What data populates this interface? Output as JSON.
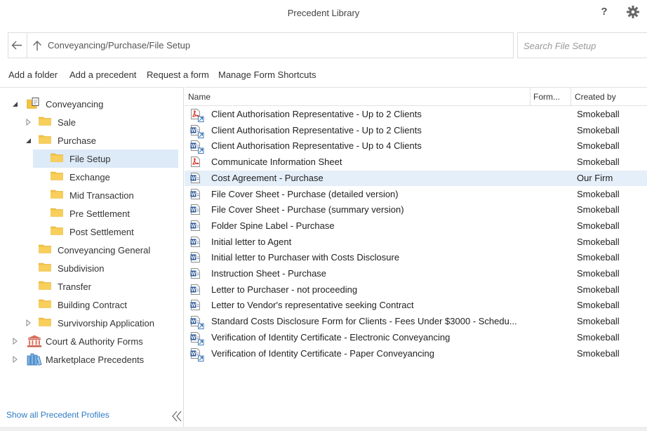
{
  "window": {
    "title": "Precedent Library",
    "help_label": "?"
  },
  "path": {
    "value": "Conveyancing/Purchase/File Setup"
  },
  "search": {
    "placeholder": "Search File Setup"
  },
  "toolbar": {
    "add_folder": "Add a folder",
    "add_precedent": "Add a precedent",
    "request_form": "Request a form",
    "manage_shortcuts": "Manage Form Shortcuts"
  },
  "tree": [
    {
      "label": "Conveyancing",
      "level": 0,
      "expanded": true,
      "icon": "conveyancing-icon"
    },
    {
      "label": "Sale",
      "level": 1,
      "expanded": false,
      "icon": "folder-icon"
    },
    {
      "label": "Purchase",
      "level": 1,
      "expanded": true,
      "icon": "folder-icon"
    },
    {
      "label": "File Setup",
      "level": 2,
      "selected": true,
      "icon": "folder-icon"
    },
    {
      "label": "Exchange",
      "level": 2,
      "icon": "folder-icon"
    },
    {
      "label": "Mid Transaction",
      "level": 2,
      "icon": "folder-icon"
    },
    {
      "label": "Pre Settlement",
      "level": 2,
      "icon": "folder-icon"
    },
    {
      "label": "Post Settlement",
      "level": 2,
      "icon": "folder-icon"
    },
    {
      "label": "Conveyancing General",
      "level": 1,
      "icon": "folder-icon"
    },
    {
      "label": "Subdivision",
      "level": 1,
      "icon": "folder-icon"
    },
    {
      "label": "Transfer",
      "level": 1,
      "icon": "folder-icon"
    },
    {
      "label": "Building Contract",
      "level": 1,
      "icon": "folder-icon"
    },
    {
      "label": "Survivorship Application",
      "level": 1,
      "expanded": false,
      "icon": "folder-icon"
    },
    {
      "label": "Court & Authority Forms",
      "level": 0,
      "expanded": false,
      "icon": "court-icon"
    },
    {
      "label": "Marketplace Precedents",
      "level": 0,
      "expanded": false,
      "icon": "marketplace-icon"
    }
  ],
  "sidebar": {
    "show_all_label": "Show all Precedent Profiles"
  },
  "list": {
    "columns": {
      "name": "Name",
      "form": "Form...",
      "created_by": "Created by"
    },
    "rows": [
      {
        "name": "Client Authorisation Representative - Up to 2 Clients",
        "created_by": "Smokeball",
        "icon": "pdf-form-icon"
      },
      {
        "name": "Client Authorisation Representative - Up to 2 Clients",
        "created_by": "Smokeball",
        "icon": "word-form-icon"
      },
      {
        "name": "Client Authorisation Representative - Up to 4 Clients",
        "created_by": "Smokeball",
        "icon": "word-form-icon"
      },
      {
        "name": "Communicate Information Sheet",
        "created_by": "Smokeball",
        "icon": "pdf-icon"
      },
      {
        "name": "Cost Agreement - Purchase",
        "created_by": "Our Firm",
        "icon": "word-icon",
        "selected": true
      },
      {
        "name": "File Cover Sheet - Purchase (detailed version)",
        "created_by": "Smokeball",
        "icon": "word-icon"
      },
      {
        "name": "File Cover Sheet - Purchase (summary version)",
        "created_by": "Smokeball",
        "icon": "word-icon"
      },
      {
        "name": "Folder Spine Label - Purchase",
        "created_by": "Smokeball",
        "icon": "word-icon"
      },
      {
        "name": "Initial letter to Agent",
        "created_by": "Smokeball",
        "icon": "word-icon"
      },
      {
        "name": "Initial letter to Purchaser with Costs Disclosure",
        "created_by": "Smokeball",
        "icon": "word-icon"
      },
      {
        "name": "Instruction Sheet - Purchase",
        "created_by": "Smokeball",
        "icon": "word-icon"
      },
      {
        "name": "Letter to Purchaser - not proceeding",
        "created_by": "Smokeball",
        "icon": "word-icon"
      },
      {
        "name": "Letter to Vendor's representative seeking Contract",
        "created_by": "Smokeball",
        "icon": "word-icon"
      },
      {
        "name": "Standard Costs Disclosure Form for Clients - Fees Under $3000 - Schedu...",
        "created_by": "Smokeball",
        "icon": "word-form-icon"
      },
      {
        "name": "Verification of Identity Certificate - Electronic Conveyancing",
        "created_by": "Smokeball",
        "icon": "word-form-icon"
      },
      {
        "name": "Verification of Identity Certificate - Paper Conveyancing",
        "created_by": "Smokeball",
        "icon": "word-form-icon"
      }
    ]
  },
  "colors": {
    "selected_tree": "#ddeaf7",
    "selected_row": "#e5eff9",
    "link": "#2e7bc4",
    "folder": "#f5c242",
    "word_blue": "#2b5797",
    "pdf_red": "#d83a2e"
  }
}
